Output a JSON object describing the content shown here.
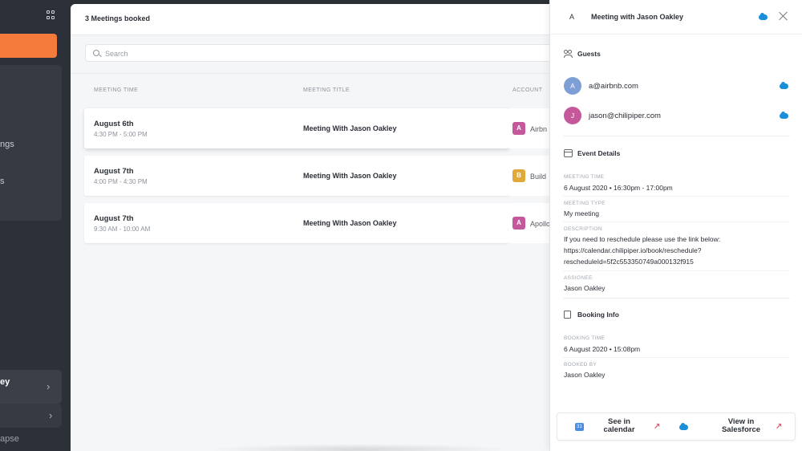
{
  "sidebar": {
    "nav_partial_1": "ngs",
    "nav_partial_2": "s",
    "user_partial": "ey",
    "collapse_partial": "apse"
  },
  "main": {
    "title": "3 Meetings booked",
    "search_placeholder": "Search",
    "columns": [
      "MEETING TIME",
      "MEETING TITLE",
      "ACCOUNT"
    ],
    "rows": [
      {
        "date": "August 6th",
        "time": "4:30 PM - 5:00 PM",
        "title": "Meeting With Jason Oakley",
        "account_initial": "A",
        "account": "Airbn",
        "account_color": "#c4589b"
      },
      {
        "date": "August 7th",
        "time": "4:00 PM - 4:30 PM",
        "title": "Meeting With Jason Oakley",
        "account_initial": "B",
        "account": "Build",
        "account_color": "#e0a93a"
      },
      {
        "date": "August 7th",
        "time": "9:30 AM - 10:00 AM",
        "title": "Meeting With Jason Oakley",
        "account_initial": "A",
        "account": "Apollo",
        "account_color": "#c4589b"
      }
    ]
  },
  "detail": {
    "letter": "A",
    "title": "Meeting with Jason Oakley",
    "guests_heading": "Guests",
    "guests": [
      {
        "initial": "A",
        "email": "a@airbnb.com",
        "color": "#7e9fd6"
      },
      {
        "initial": "J",
        "email": "jason@chilipiper.com",
        "color": "#c4589b"
      }
    ],
    "event_heading": "Event Details",
    "meeting_time_label": "MEETING TIME",
    "meeting_time": "6 August 2020 • 16:30pm - 17:00pm",
    "meeting_type_label": "MEETING TYPE",
    "meeting_type": "My meeting",
    "description_label": "DESCRIPTION",
    "description_line1": "If you need to reschedule please use the link below:",
    "description_line2": "https://calendar.chilipiper.io/book/reschedule?",
    "description_line3": "rescheduleId=5f2c553350749a000132f915",
    "assignee_label": "ASSIGNEE",
    "assignee": "Jason Oakley",
    "booking_heading": "Booking Info",
    "booking_time_label": "BOOKING TIME",
    "booking_time": "6 August 2020 • 15:08pm",
    "booked_by_label": "BOOKED BY",
    "booked_by": "Jason Oakley",
    "see_line1": "See in",
    "see_line2": "calendar",
    "view_line1": "View in",
    "view_line2": "Salesforce",
    "calendar_glyph": "31",
    "arrow_glyph": "↗"
  },
  "colors": {
    "accent": "#f47b3c",
    "salesforce": "#1a8fd9",
    "external_arrow": "#e55a7a"
  }
}
